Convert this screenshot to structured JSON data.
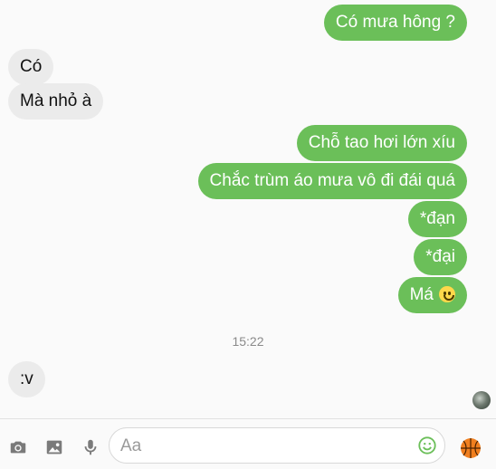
{
  "messages": [
    {
      "text": "Có mưa hông ?",
      "side": "out"
    },
    {
      "text": "Có",
      "side": "in"
    },
    {
      "text": "Mà nhỏ à",
      "side": "in"
    },
    {
      "text": "Chỗ tao hơi lớn xíu",
      "side": "out"
    },
    {
      "text": "Chắc trùm áo mưa vô đi đái quá",
      "side": "out"
    },
    {
      "text": "*đạn",
      "side": "out"
    },
    {
      "text": "*đại",
      "side": "out"
    },
    {
      "text": "Má",
      "side": "out",
      "emoji": "slightly-smiling-face"
    },
    {
      "text": ":v",
      "side": "in"
    }
  ],
  "timestamp": "15:22",
  "composer": {
    "placeholder": "Aa",
    "icons": [
      "camera-icon",
      "image-icon",
      "microphone-icon",
      "emoji-icon",
      "basketball-icon"
    ]
  },
  "colors": {
    "outgoing_bubble": "#6bbf59",
    "incoming_bubble": "#ebebeb",
    "accent": "#6bbf59"
  }
}
